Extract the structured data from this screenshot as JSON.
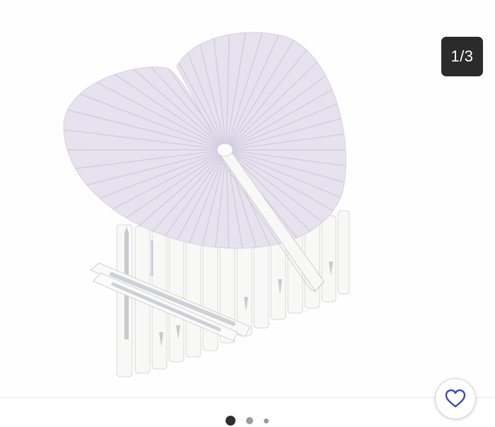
{
  "gallery": {
    "counter": "1/3",
    "image_subject": "heart-shaped-paper-fans",
    "current_index": 1,
    "total": 3
  },
  "favorite": {
    "icon": "heart-outline-icon",
    "color": "#3b4fa8"
  },
  "colors": {
    "fan": "#e6e3ee",
    "handle": "#f8f8f6",
    "counter_bg": "#2b2b2b"
  }
}
